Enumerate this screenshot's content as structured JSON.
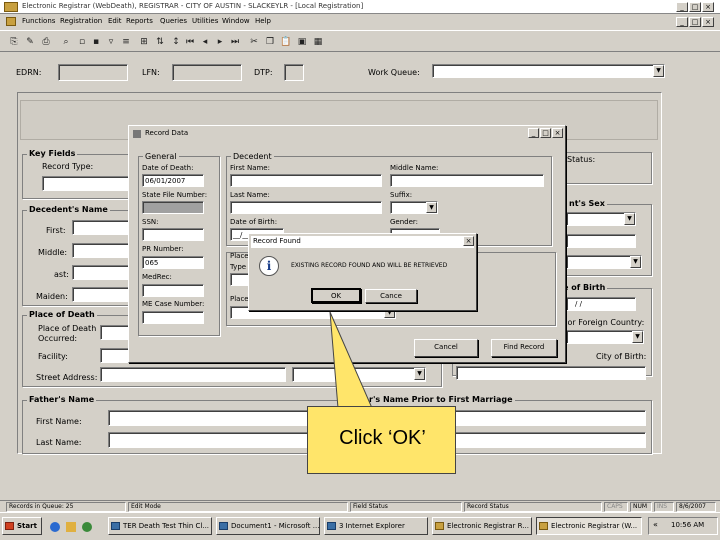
{
  "window": {
    "title": "Electronic Registrar (WebDeath), REGISTRAR - CITY OF AUSTIN - SLACKEYLR - [Local Registration]"
  },
  "menu": [
    "Functions",
    "Registration",
    "Edit",
    "Reports",
    "Queries",
    "Utilities",
    "Window",
    "Help"
  ],
  "header": {
    "edrn_label": "EDRN:",
    "lfn_label": "LFN:",
    "dtp_label": "DTP:",
    "work_queue_label": "Work Queue:"
  },
  "form": {
    "key_fields_title": "Key Fields",
    "record_type_label": "Record Type:",
    "status_label": "Status:",
    "decedent_name_title": "Decedent's Name",
    "first_label": "First:",
    "middle_label": "Middle:",
    "last_label": "ast:",
    "maiden_label": "Maiden:",
    "sex_title": "nt's Sex",
    "birth_title": "e of Birth",
    "birth_date_value": "/  /",
    "us_foreign_label": "US or Foreign Country:",
    "city_of_birth_label": "City of Birth:",
    "place_of_death_title": "Place of Death",
    "place_of_death_label": "Place of Death",
    "occurred_label": "Occurred:",
    "facility_label": "Facility:",
    "street_label": "Street Address:",
    "fathers_name_title": "Father's Name",
    "mothers_name_title": "r's Name Prior to First Marriage",
    "father_first_label": "First Name:",
    "father_last_label": "Last Name:"
  },
  "record_dialog": {
    "title": "Record Data",
    "general_title": "General",
    "date_of_death_label": "Date of Death:",
    "date_of_death_value": "06/01/2007",
    "state_file_number_label": "State File Number:",
    "ssn_label": "SSN:",
    "pr_number_label": "PR Number:",
    "pr_number_value": "065",
    "medrec_label": "MedRec:",
    "me_case_label": "ME Case Number:",
    "decedent_title": "Decedent",
    "first_name_label": "First Name:",
    "middle_name_label": "Middle Name:",
    "last_name_label": "Last Name:",
    "suffix_label": "Suffix:",
    "dob_label": "Date of Birth:",
    "dob_value": "__/__",
    "gender_label": "Gender:",
    "place_label": "Place",
    "type_label": "Type",
    "place2_label": "Place",
    "cancel_label": "Cancel",
    "find_record_label": "Find Record"
  },
  "record_found": {
    "title": "Record Found",
    "message": "EXISTING RECORD FOUND AND WILL BE RETRIEVED",
    "ok_label": "OK",
    "cancel_label": "Cance"
  },
  "callout": {
    "text": "Click ‘OK’"
  },
  "statusbar": {
    "records": "Records in Queue: 25",
    "edit_mode": "Edit Mode",
    "field_status": "Field Status",
    "record_status": "Record Status",
    "caps": "CAPS",
    "num": "NUM",
    "ins": "INS",
    "date": "8/6/2007"
  },
  "taskbar": {
    "start": "Start",
    "tasks": [
      "TER Death Test Thin Cl...",
      "Document1 - Microsoft ...",
      "3 Internet Explorer",
      "Electronic Registrar R...",
      "Electronic Registrar (W..."
    ],
    "clock": "10:56 AM"
  }
}
